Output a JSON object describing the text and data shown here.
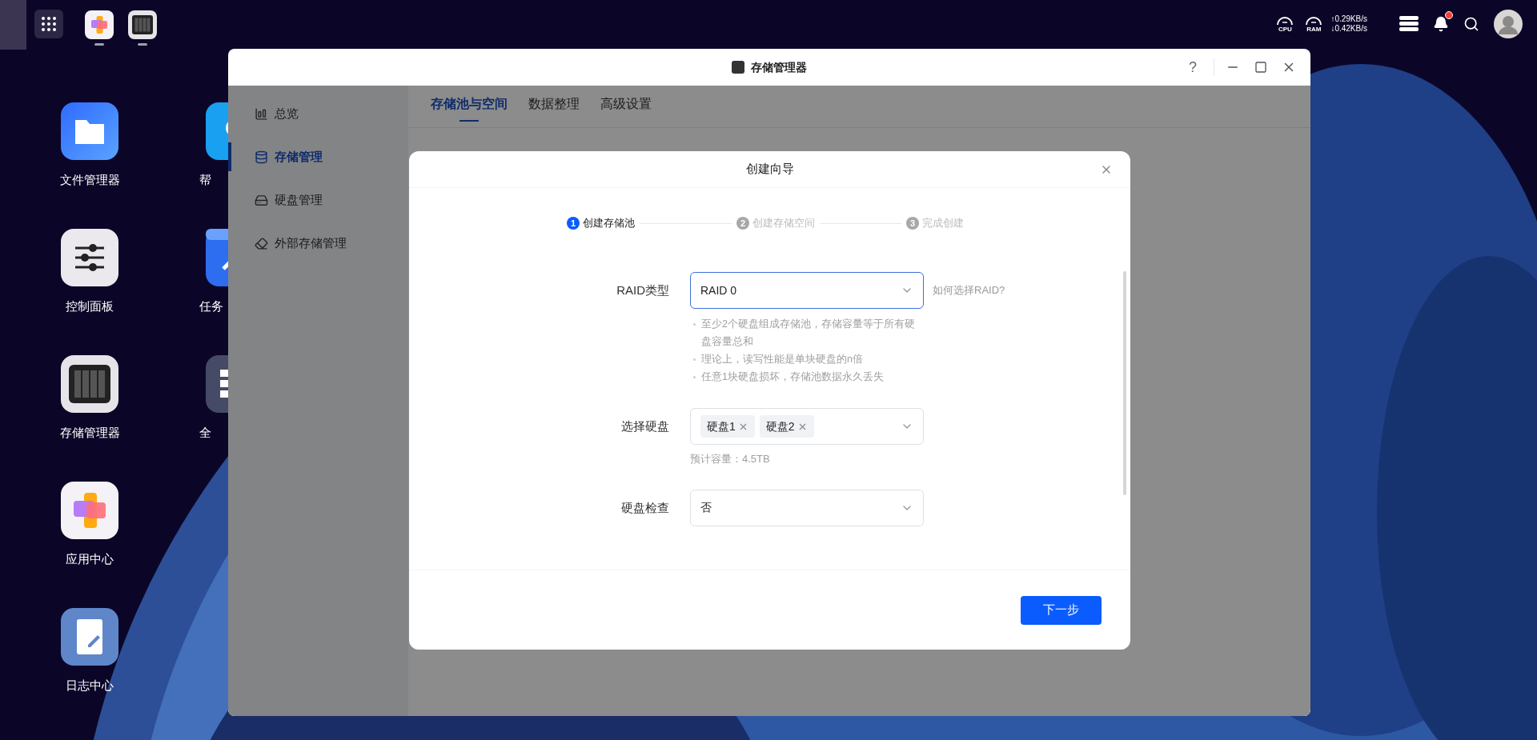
{
  "taskbar": {
    "pinned_apps": [
      {
        "kind": "appcenter",
        "running": true
      },
      {
        "kind": "storage",
        "running": true
      }
    ]
  },
  "system_tray": {
    "cpu_label": "CPU",
    "ram_label": "RAM",
    "upload": "↑0.29KB/s",
    "download": "↓0.42KB/s",
    "has_unread": true
  },
  "desktop_icons": [
    {
      "label": "文件管理器",
      "kind": "files"
    },
    {
      "label": "控制面板",
      "kind": "control"
    },
    {
      "label": "存储管理器",
      "kind": "storage"
    },
    {
      "label": "应用中心",
      "kind": "appcenter"
    },
    {
      "label": "日志中心",
      "kind": "log"
    },
    {
      "label": "帮",
      "kind": "help"
    },
    {
      "label": "任务",
      "kind": "tasks"
    },
    {
      "label": "全",
      "kind": "global"
    }
  ],
  "window": {
    "title": "存储管理器",
    "help_button": "?",
    "sidebar": [
      {
        "label": "总览",
        "kind": "overview",
        "selected": false
      },
      {
        "label": "存储管理",
        "kind": "storage",
        "selected": true
      },
      {
        "label": "硬盘管理",
        "kind": "disk",
        "selected": false
      },
      {
        "label": "外部存储管理",
        "kind": "external",
        "selected": false
      }
    ],
    "tabs": [
      {
        "label": "存储池与空间",
        "selected": true
      },
      {
        "label": "数据整理",
        "selected": false
      },
      {
        "label": "高级设置",
        "selected": false
      }
    ]
  },
  "dialog": {
    "title": "创建向导",
    "steps": [
      {
        "number": "1",
        "label": "创建存储池",
        "active": true
      },
      {
        "number": "2",
        "label": "创建存储空间",
        "active": false
      },
      {
        "number": "3",
        "label": "完成创建",
        "active": false
      }
    ],
    "fields": [
      {
        "label": "RAID类型",
        "value": "RAID 0",
        "focused": true,
        "help_link": "如何选择RAID?",
        "hints": [
          "至少2个硬盘组成存储池，存储容量等于所有硬盘容量总和",
          "理论上，读写性能是单块硬盘的n倍",
          "任意1块硬盘损坏，存储池数据永久丢失"
        ]
      },
      {
        "label": "选择硬盘",
        "focused": false,
        "tags": [
          "硬盘1",
          "硬盘2"
        ],
        "note": "预计容量：4.5TB"
      },
      {
        "label": "硬盘检查",
        "focused": false,
        "value": "否"
      }
    ],
    "next_button": "下一步"
  }
}
